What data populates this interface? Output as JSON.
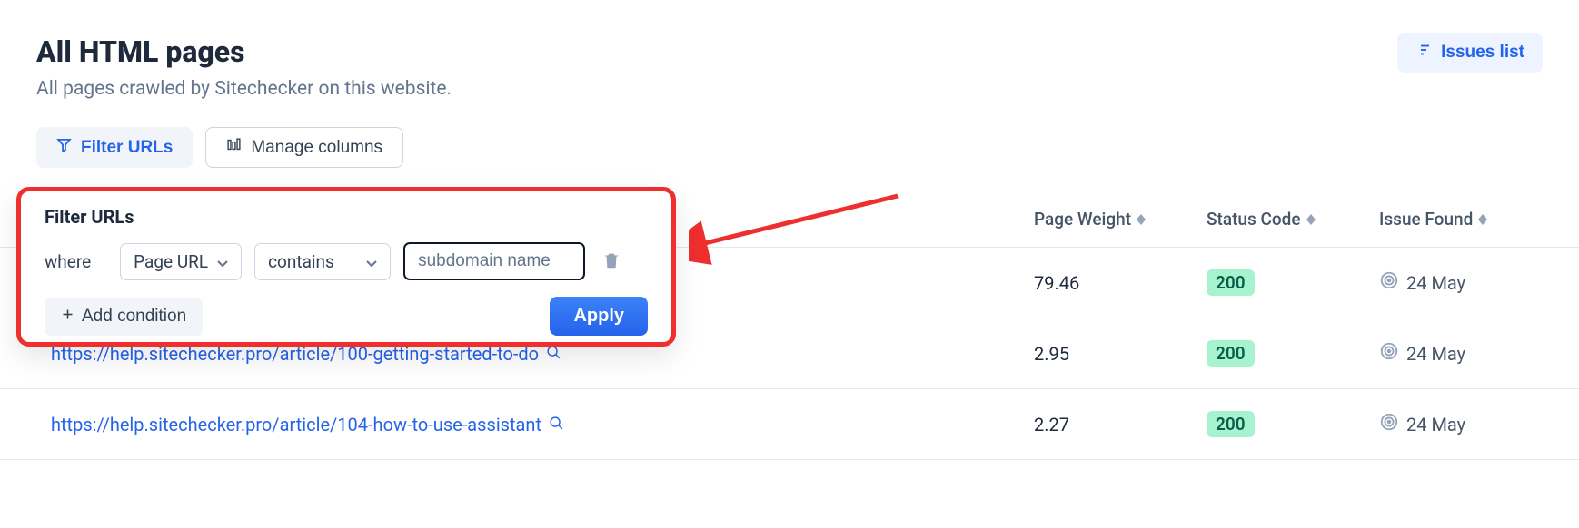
{
  "header": {
    "title": "All HTML pages",
    "subtitle": "All pages crawled by Sitechecker on this website.",
    "issues_list_label": "Issues list"
  },
  "toolbar": {
    "filter_urls_label": "Filter URLs",
    "manage_columns_label": "Manage columns"
  },
  "filter_panel": {
    "title": "Filter URLs",
    "where_label": "where",
    "field_select": "Page URL",
    "operator_select": "contains",
    "value_input": "subdomain name",
    "add_condition_label": "Add condition",
    "apply_label": "Apply"
  },
  "table": {
    "headers": {
      "page_weight": "Page Weight",
      "status_code": "Status Code",
      "issue_found": "Issue Found"
    },
    "rows": [
      {
        "url": "",
        "page_weight": "79.46",
        "status_code": "200",
        "issue_date": "24 May"
      },
      {
        "url": "https://help.sitechecker.pro/article/100-getting-started-to-do",
        "page_weight": "2.95",
        "status_code": "200",
        "issue_date": "24 May"
      },
      {
        "url": "https://help.sitechecker.pro/article/104-how-to-use-assistant",
        "page_weight": "2.27",
        "status_code": "200",
        "issue_date": "24 May"
      }
    ]
  }
}
